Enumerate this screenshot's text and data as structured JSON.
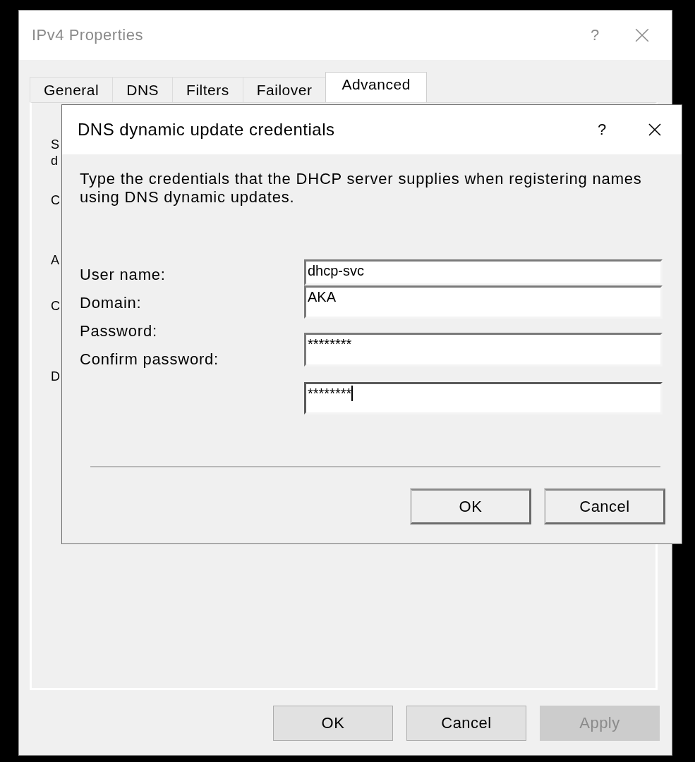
{
  "window": {
    "title": "IPv4 Properties",
    "help": "?"
  },
  "tabs": [
    {
      "label": "General",
      "selected": false
    },
    {
      "label": "DNS",
      "selected": false
    },
    {
      "label": "Filters",
      "selected": false
    },
    {
      "label": "Failover",
      "selected": false
    },
    {
      "label": "Advanced",
      "selected": true
    }
  ],
  "panel": {
    "text_fragments": [
      "S",
      "d",
      "C",
      "A",
      "C",
      "D"
    ]
  },
  "dialog": {
    "title": "DNS dynamic update credentials",
    "help": "?",
    "description": "Type the credentials that the DHCP server supplies when registering names using DNS dynamic updates.",
    "fields": [
      {
        "label": "User name:",
        "value": "dhcp-svc",
        "focused": false
      },
      {
        "label": "Domain:",
        "value": "AKA",
        "focused": false
      },
      {
        "label": "Password:",
        "value": "********",
        "focused": false
      },
      {
        "label": "Confirm password:",
        "value": "********",
        "focused": true
      }
    ],
    "buttons": [
      {
        "label": "OK"
      },
      {
        "label": "Cancel"
      }
    ]
  },
  "buttons": [
    {
      "label": "OK",
      "disabled": false
    },
    {
      "label": "Cancel",
      "disabled": false
    },
    {
      "label": "Apply",
      "disabled": true
    }
  ]
}
